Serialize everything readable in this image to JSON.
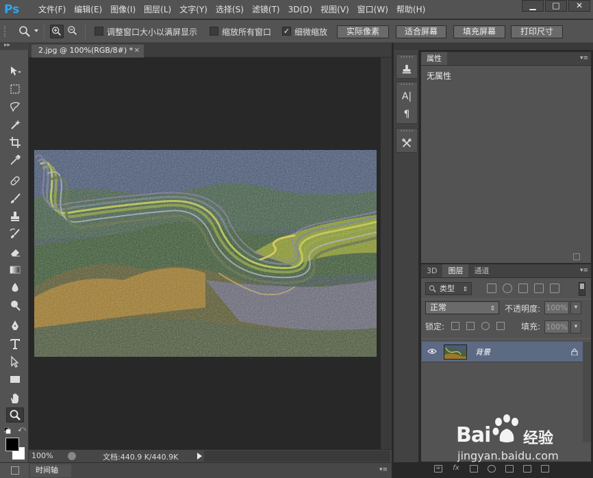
{
  "app": {
    "logo": "Ps"
  },
  "menu": [
    "文件(F)",
    "编辑(E)",
    "图像(I)",
    "图层(L)",
    "文字(Y)",
    "选择(S)",
    "滤镜(T)",
    "3D(D)",
    "视图(V)",
    "窗口(W)",
    "帮助(H)"
  ],
  "window_controls": {
    "minimize": "▁",
    "maximize": "□",
    "close": "✕"
  },
  "options": {
    "resize_windows_label": "调整窗口大小以满屏显示",
    "resize_windows_checked": false,
    "zoom_all_label": "缩放所有窗口",
    "zoom_all_checked": false,
    "scrubby_zoom_label": "细微缩放",
    "scrubby_zoom_checked": true,
    "check_mark": "✓",
    "actual_pixels": "实际像素",
    "fit_screen": "适合屏幕",
    "fill_screen": "填充屏幕",
    "print_size": "打印尺寸"
  },
  "tools": [
    "move-tool",
    "rect-marquee-tool",
    "lasso-tool",
    "magic-wand-tool",
    "crop-tool",
    "eyedropper-tool",
    "healing-brush-tool",
    "brush-tool",
    "clone-stamp-tool",
    "history-brush-tool",
    "eraser-tool",
    "gradient-tool",
    "blur-tool",
    "dodge-tool",
    "pen-tool",
    "type-tool",
    "path-selection-tool",
    "rectangle-tool",
    "hand-tool",
    "zoom-tool"
  ],
  "document": {
    "tab_title": "2.jpg @ 100%(RGB/8#) *",
    "tab_close": "×",
    "zoom": "100%",
    "doc_info": "文档:440.9 K/440.9K"
  },
  "dock": {
    "type_icon": "A|",
    "paragraph_icon": "¶"
  },
  "properties": {
    "tab": "属性",
    "empty_text": "无属性"
  },
  "layers_panel": {
    "tabs": [
      "3D",
      "图层",
      "通道"
    ],
    "active_tab": 1,
    "filter_label": "类型",
    "blend_mode": "正常",
    "opacity_label": "不透明度:",
    "opacity_value": "100%",
    "lock_label": "锁定:",
    "fill_label": "填充:",
    "fill_value": "100%",
    "layers": [
      {
        "name": "背景",
        "visible": true,
        "locked": true
      }
    ],
    "footer_fx": "fx"
  },
  "timeline": {
    "tab": "时间轴"
  },
  "colors": {
    "ps_blue": "#29a8ff",
    "panel": "#535353",
    "canvas_bg": "#282828",
    "selected_layer": "#5d6a84",
    "foreground": "#000000",
    "background": "#ffffff"
  },
  "watermark": {
    "brand": "Bai",
    "brand2": "经验",
    "url": "jingyan.baidu.com"
  }
}
